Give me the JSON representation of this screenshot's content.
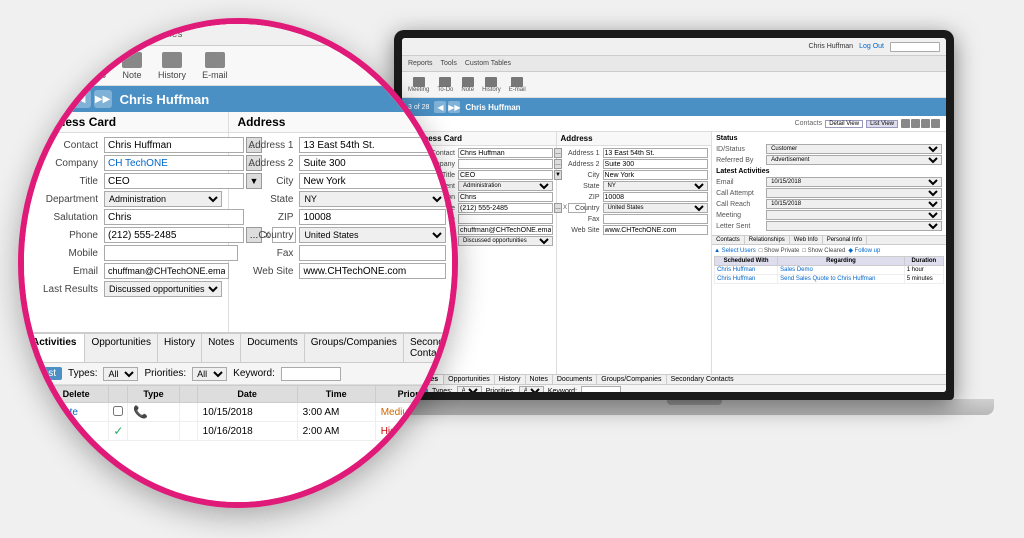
{
  "app": {
    "title": "Contacts",
    "user": "Chris Huffman",
    "logout": "Log Out",
    "record_count": "3 of 28",
    "contact_name": "Chris Huffman"
  },
  "toolbar": {
    "items": [
      {
        "label": "Meeting",
        "icon": "calendar"
      },
      {
        "label": "To-Do",
        "icon": "check"
      },
      {
        "label": "Note",
        "icon": "note"
      },
      {
        "label": "History",
        "icon": "history"
      },
      {
        "label": "E-mail",
        "icon": "email"
      }
    ]
  },
  "menu": {
    "items": [
      "Reports",
      "Tools",
      "Custom Tables"
    ]
  },
  "tabs": {
    "detail_view": "Detail View",
    "list_view": "List View"
  },
  "business_card": {
    "title": "Business Card",
    "fields": {
      "contact_label": "Contact",
      "contact_value": "Chris Huffman",
      "company_label": "Company",
      "company_value": "CH TechONE",
      "title_label": "Title",
      "title_value": "CEO",
      "department_label": "Department",
      "department_value": "Administration",
      "salutation_label": "Salutation",
      "salutation_value": "Chris",
      "phone_label": "Phone",
      "phone_value": "(212) 555-2485",
      "phone_ext": "X",
      "mobile_label": "Mobile",
      "mobile_value": "",
      "email_label": "Email",
      "email_value": "chuffman@CHTechONE.email",
      "last_results_label": "Last Results",
      "last_results_value": "Discussed opportunities"
    }
  },
  "address": {
    "title": "Address",
    "fields": {
      "address1_label": "Address 1",
      "address1_value": "13 East 54th St.",
      "address2_label": "Address 2",
      "address2_value": "Suite 300",
      "city_label": "City",
      "city_value": "New York",
      "state_label": "State",
      "state_value": "NY",
      "zip_label": "ZIP",
      "zip_value": "10008",
      "country_label": "Country",
      "country_value": "United States",
      "fax_label": "Fax",
      "fax_value": "",
      "website_label": "Web Site",
      "website_value": "www.CHTechONE.com"
    }
  },
  "status": {
    "title": "Status",
    "fields": {
      "status_label": "ID/Status",
      "status_value": "Customer",
      "referred_label": "Referred By",
      "referred_value": "Advertisement"
    }
  },
  "latest_activities": {
    "title": "Latest Activities",
    "fields": {
      "email_label": "Email",
      "email_value": "10/15/2018",
      "call_attempt_label": "Call Attempt",
      "call_attempt_value": "",
      "call_reach_label": "Call Reach",
      "call_reach_value": "10/15/2018",
      "meeting_label": "Meeting",
      "meeting_value": "",
      "letter_sent_label": "Letter Sent",
      "letter_sent_value": ""
    }
  },
  "activities_section": {
    "tabs": [
      "Activities",
      "Opportunities",
      "History",
      "Notes",
      "Documents",
      "Groups/Companies",
      "Secondary Contacts"
    ],
    "filter_label": "Past",
    "types_label": "Types:",
    "types_value": "All",
    "priorities_label": "Priorities:",
    "priorities_value": "All",
    "keyword_label": "Keyword:",
    "table_headers": [
      "",
      "Delete",
      "",
      "Type",
      "",
      "Date",
      "Time",
      "Priority"
    ],
    "rows": [
      {
        "delete": "Delete",
        "type_icon": "phone",
        "date": "10/15/2018",
        "time": "3:00 AM",
        "priority": "Medium",
        "priority_class": "priority-medium"
      },
      {
        "delete": "",
        "type_icon": "check",
        "date": "10/16/2018",
        "time": "2:00 AM",
        "priority": "High",
        "priority_class": "priority-high"
      }
    ]
  },
  "scheduled_activities": {
    "headers": [
      "Scheduled With",
      "Regarding",
      "Duration"
    ],
    "rows": [
      {
        "with": "Chris Huffman",
        "regarding": "Sales Demo",
        "duration": "1 hour"
      },
      {
        "with": "Chris Huffman",
        "regarding": "Send Sales Quote to Chris Huffman",
        "duration": "5 minutes"
      }
    ]
  }
}
